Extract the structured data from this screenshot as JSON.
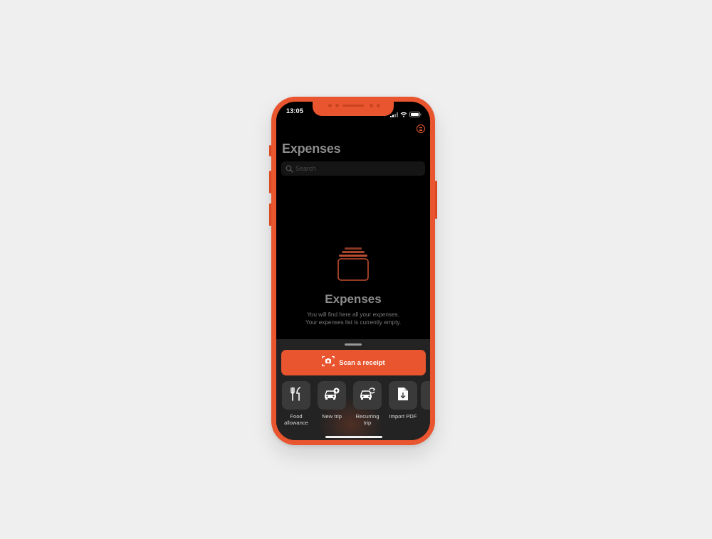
{
  "status_bar": {
    "time": "13:05"
  },
  "header": {
    "title": "Expenses",
    "menu_icon": "menu-lines-icon"
  },
  "search": {
    "placeholder": "Search"
  },
  "empty_state": {
    "icon": "folder-stack-icon",
    "title": "Expenses",
    "line1": "You will find here all your expenses.",
    "line2": "Your expenses list is currently empty."
  },
  "sheet": {
    "scan_button": {
      "label": "Scan a receipt",
      "icon": "camera-scan-icon"
    },
    "actions": [
      {
        "label_line1": "Food",
        "label_line2": "allowance",
        "icon": "fork-knife-icon"
      },
      {
        "label_line1": "New trip",
        "label_line2": "",
        "icon": "car-plus-icon"
      },
      {
        "label_line1": "Recurring",
        "label_line2": "trip",
        "icon": "car-repeat-icon"
      },
      {
        "label_line1": "Import PDF",
        "label_line2": "",
        "icon": "file-download-icon"
      }
    ]
  },
  "colors": {
    "accent": "#e8552e",
    "background": "#000000",
    "sheet": "#232323",
    "tile": "#3a3a3a",
    "page": "#efefef"
  }
}
